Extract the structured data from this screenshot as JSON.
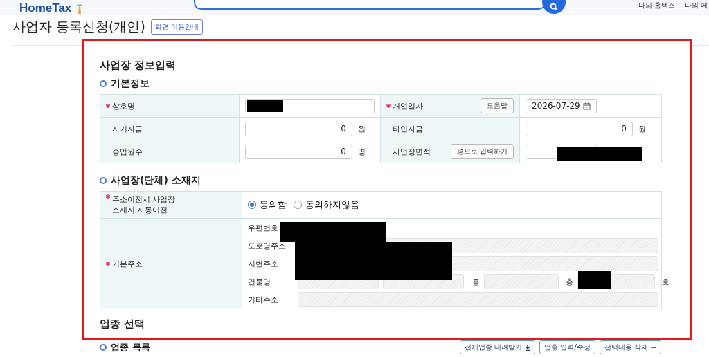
{
  "header": {
    "logo": "HomeTax",
    "links": [
      "나의 홈택스",
      "나의 메"
    ]
  },
  "page": {
    "title": "사업자 등록신청(개인)",
    "guide_button": "화면 이용안내"
  },
  "form": {
    "heading": "사업장 정보입력",
    "basic_info": {
      "title": "기본정보",
      "rows": [
        {
          "left": {
            "label": "상호명",
            "required": true,
            "field": {
              "kind": "redacted"
            }
          },
          "right": {
            "label": "개업일자",
            "required": true,
            "button": "도움말",
            "field": {
              "kind": "date",
              "value": "2026-07-29"
            }
          }
        },
        {
          "left": {
            "label": "자기자금",
            "required": false,
            "field": {
              "kind": "number",
              "value": "0",
              "unit": "원"
            }
          },
          "right": {
            "label": "타인자금",
            "required": false,
            "field": {
              "kind": "number",
              "value": "0",
              "unit": "원"
            }
          }
        },
        {
          "left": {
            "label": "종업원수",
            "required": false,
            "field": {
              "kind": "number",
              "value": "0",
              "unit": "명"
            }
          },
          "right": {
            "label": "사업장면적",
            "required": false,
            "button": "평으로 입력하기",
            "field": {
              "kind": "redacted"
            }
          }
        }
      ]
    },
    "location": {
      "title": "사업장(단체) 소재지",
      "consent": {
        "label_lines": [
          "주소이전시 사업장",
          "소재지 자동이전"
        ],
        "required": true,
        "options": [
          {
            "label": "동의함",
            "selected": true
          },
          {
            "label": "동의하지않음",
            "selected": false
          }
        ]
      },
      "address": {
        "label": "기본주소",
        "required": true,
        "postal_label": "우편번호",
        "road_label": "도로명주소",
        "lot_label": "지번주소",
        "building_label": "건물명",
        "building_units": [
          "동",
          "층",
          "호"
        ],
        "other_label": "기타주소"
      }
    },
    "industry_heading": "업종 선택"
  },
  "industry_list": {
    "title": "업종 목록",
    "buttons": [
      {
        "label": "전체업종 내려받기",
        "kind": "download"
      },
      {
        "label": "업종 입력/수정",
        "kind": "plain"
      },
      {
        "label": "선택내용 삭제",
        "kind": "remove"
      }
    ]
  }
}
